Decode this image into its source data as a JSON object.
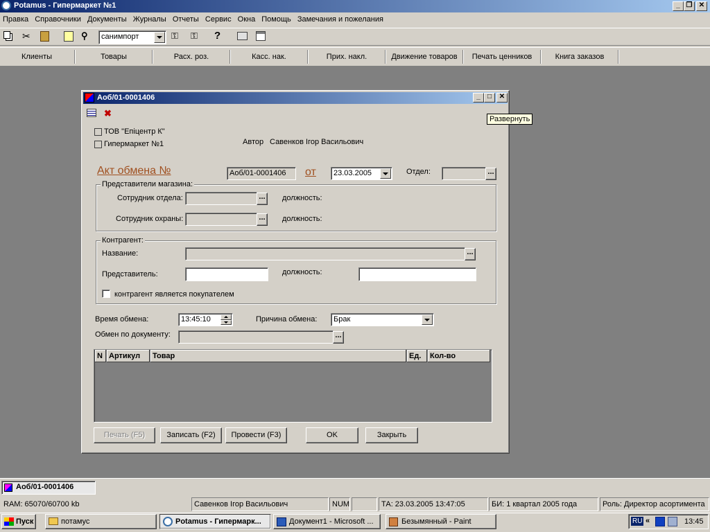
{
  "app": {
    "title": "Potamus - Гипермаркет №1",
    "menu": [
      "Правка",
      "Справочники",
      "Документы",
      "Журналы",
      "Отчеты",
      "Сервис",
      "Окна",
      "Помощь",
      "Замечания и пожелания"
    ],
    "toolbar_combo": "санимпорт",
    "nav": [
      "Клиенты",
      "Товары",
      "Расх. роз.",
      "Касс. нак.",
      "Прих. накл.",
      "Движение товаров",
      "Печать ценников",
      "Книга заказов"
    ]
  },
  "doc": {
    "title": "Аоб/01-0001406",
    "tooltip": "Развернуть",
    "company": "ТОВ \"Епіцентр К\"",
    "store": "Гипермаркет №1",
    "author_label": "Автор",
    "author": "Савенков Ігор Васильович",
    "heading": "Акт обмена №",
    "number": "Аоб/01-0001406",
    "from_label": "от",
    "date": "23.03.2005",
    "dept_label": "Отдел:",
    "dept_value": "",
    "store_reps": {
      "title": "Представители магазина:",
      "employee_label": "Сотрудник отдела:",
      "employee_value": "",
      "guard_label": "Сотрудник охраны:",
      "guard_value": "",
      "position_label": "должность:"
    },
    "contractor": {
      "title": "Контрагент:",
      "name_label": "Название:",
      "name_value": "",
      "rep_label": "Представитель:",
      "rep_value": "",
      "position_label": "должность:",
      "position_value": "",
      "buyer_label": "контрагент является покупателем",
      "buyer_checked": false
    },
    "time_label": "Время обмена:",
    "time_value": "13:45:10",
    "reason_label": "Причина обмена:",
    "reason_value": "Брак",
    "by_doc_label": "Обмен по документу:",
    "by_doc_value": "",
    "table": {
      "columns": [
        "N",
        "Артикул",
        "Товар",
        "Ед.",
        "Кол-во"
      ],
      "rows": []
    },
    "buttons": {
      "print": "Печать (F5)",
      "save": "Записать (F2)",
      "post": "Провести (F3)",
      "ok": "OK",
      "close": "Закрыть"
    },
    "dots": "..."
  },
  "window_tab": "Аоб/01-0001406",
  "status": {
    "ram": "RAM: 65070/60700 kb",
    "user": "Савенков Ігор Васильович",
    "num": "NUM",
    "ta": "ТА: 23.03.2005 13:47:05",
    "bi": "БИ: 1 квартал 2005 года",
    "role": "Роль: Директор асортимента"
  },
  "taskbar": {
    "start": "Пуск",
    "tasks": [
      "потамус",
      "Potamus - Гипермарк...",
      "Документ1 - Microsoft ...",
      "Безымянный - Paint"
    ],
    "lang": "RU",
    "clock": "13:45"
  }
}
